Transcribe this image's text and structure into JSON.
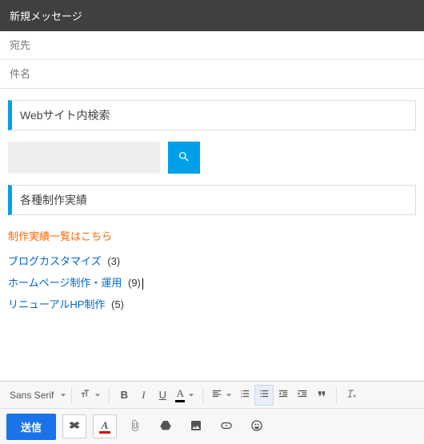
{
  "window": {
    "title": "新規メッセージ"
  },
  "fields": {
    "to_placeholder": "宛先",
    "subject_placeholder": "件名"
  },
  "body": {
    "section_search_title": "Webサイト内検索",
    "section_works_title": "各種制作実績",
    "works_link": "制作実績一覧はこちら",
    "categories": [
      {
        "label": "ブログカスタマイズ",
        "count": "(3)"
      },
      {
        "label": "ホームページ制作・運用",
        "count": "(9)"
      },
      {
        "label": "リニューアルHP制作",
        "count": "(5)"
      }
    ]
  },
  "toolbar": {
    "font_family": "Sans Serif",
    "send_label": "送信"
  }
}
